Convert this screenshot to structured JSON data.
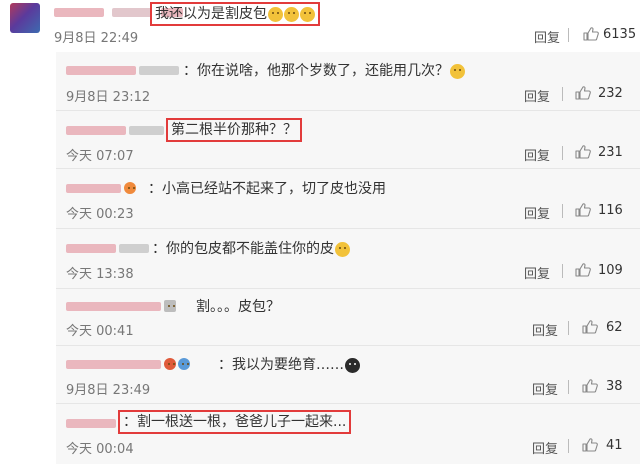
{
  "top_comment": {
    "text": "我还以为是割皮包",
    "time": "9月8日 22:49",
    "reply": "回复",
    "likes": "6135"
  },
  "replies": [
    {
      "text": "：你在说啥，他那个岁数了，还能用几次？",
      "time": "9月8日 23:12",
      "reply": "回复",
      "likes": "232",
      "highlighted": false
    },
    {
      "text": "第二根半价那种？？",
      "time": "今天 07:07",
      "reply": "回复",
      "likes": "231",
      "highlighted": true
    },
    {
      "text": "：小高已经站不起来了，切了皮也没用",
      "time": "今天 00:23",
      "reply": "回复",
      "likes": "116",
      "highlighted": false
    },
    {
      "text": "：你的包皮都不能盖住你的皮",
      "time": "今天 13:38",
      "reply": "回复",
      "likes": "109",
      "highlighted": false
    },
    {
      "text": "割。。。皮包？",
      "time": "今天 00:41",
      "reply": "回复",
      "likes": "62",
      "highlighted": false
    },
    {
      "text": "：我以为要绝育……",
      "time": "9月8日 23:49",
      "reply": "回复",
      "likes": "38",
      "highlighted": false
    },
    {
      "text": "：割一根送一根，爸爸儿子一起来...",
      "time": "今天 00:04",
      "reply": "回复",
      "likes": "41",
      "highlighted": true
    }
  ]
}
